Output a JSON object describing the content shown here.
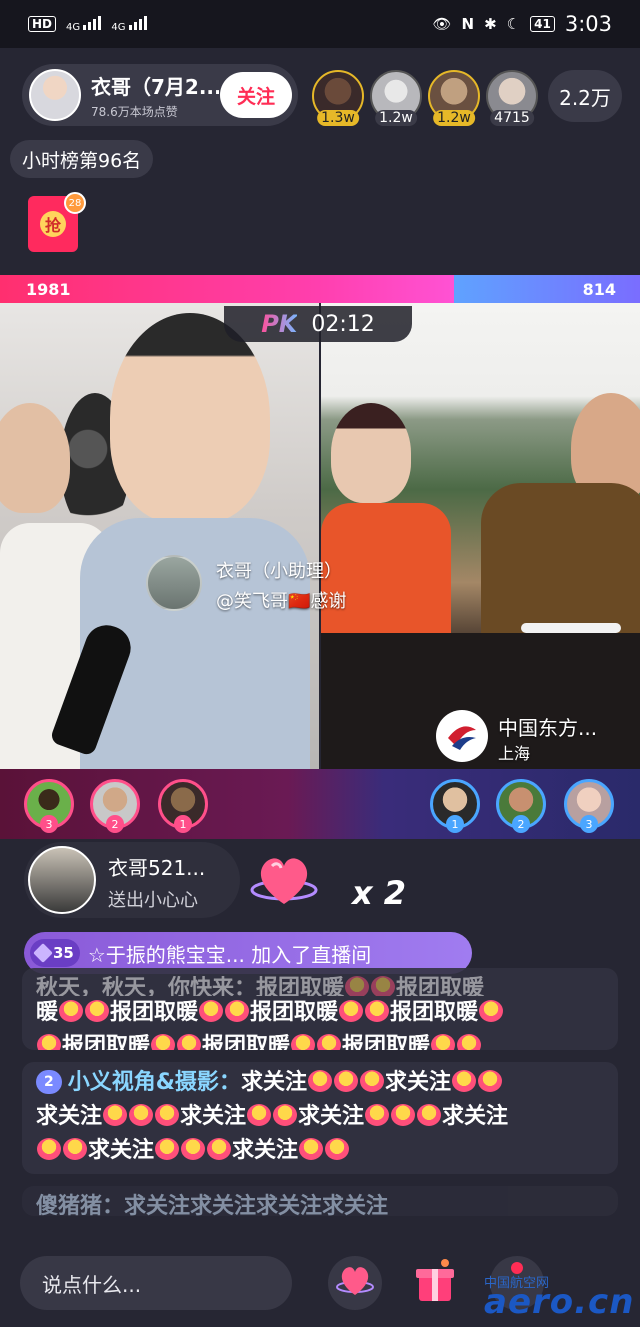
{
  "status_bar": {
    "left_chip": "HD",
    "sim1": "4G",
    "sim2": "4G",
    "battery": "41",
    "time": "3:03"
  },
  "host": {
    "name": "衣哥（7月2...",
    "likes": "78.6万本场点赞",
    "follow_label": "关注"
  },
  "viewers": [
    {
      "badge": "1.3w",
      "style": "gold"
    },
    {
      "badge": "1.2w",
      "style": "normal"
    },
    {
      "badge": "1.2w",
      "style": "gold"
    },
    {
      "badge": "4715",
      "style": "normal"
    }
  ],
  "viewer_count": "2.2万",
  "hourly_rank": "小时榜第96名",
  "red_packet": {
    "char": "抢",
    "count": "28"
  },
  "pk": {
    "left_score": "1981",
    "right_score": "814",
    "logo": "PK",
    "timer": "02:12"
  },
  "assistant_overlay": {
    "title": "衣哥（小助理）",
    "line": "@笑飞哥🇨🇳感谢"
  },
  "opponent_anchor": {
    "name": "中国东方...",
    "location": "上海"
  },
  "supporters_left": [
    "3",
    "2",
    "1"
  ],
  "supporters_right": [
    "1",
    "2",
    "3"
  ],
  "gift": {
    "user": "衣哥521...",
    "action": "送出小心心",
    "count": "x 2"
  },
  "join_banner": {
    "level": "35",
    "text": "☆于振的熊宝宝... 加入了直播间"
  },
  "chat": {
    "m1_faded": "秋天，秋天，你快来：报团取暖",
    "m1_word": "报团取暖",
    "m1_head": "暖",
    "m2_level": "2",
    "m2_nick": "小义视角&摄影：",
    "m2_word": "求关注",
    "m3_text": "傻猪猪：求关注求关注求关注求关注"
  },
  "input_placeholder": "说点什么...",
  "watermark": {
    "small": "中国航空网",
    "big": "aero.cn"
  }
}
